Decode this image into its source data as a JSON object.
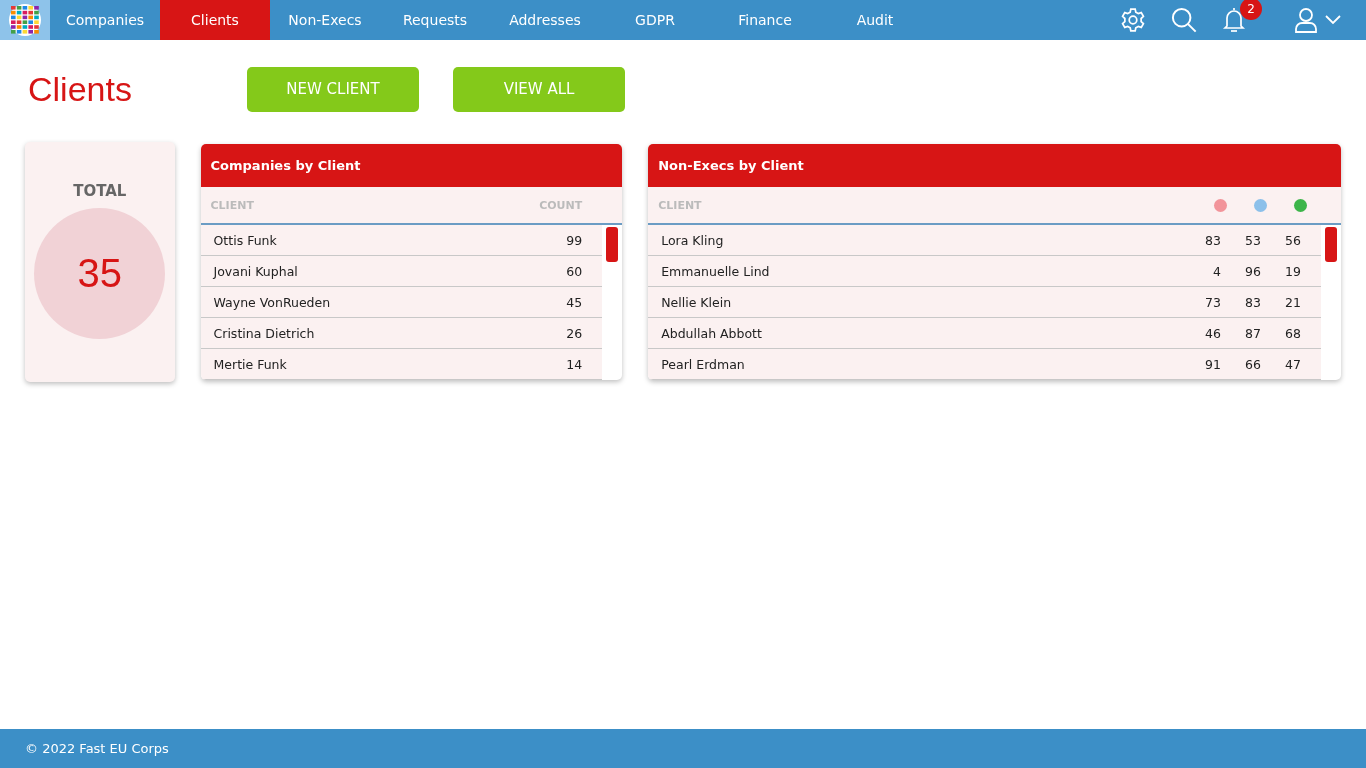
{
  "nav": {
    "items": [
      {
        "label": "Companies",
        "selected": false
      },
      {
        "label": "Clients",
        "selected": true
      },
      {
        "label": "Non-Execs",
        "selected": false
      },
      {
        "label": "Requests",
        "selected": false
      },
      {
        "label": "Addresses",
        "selected": false
      },
      {
        "label": "GDPR",
        "selected": false
      },
      {
        "label": "Finance",
        "selected": false
      },
      {
        "label": "Audit",
        "selected": false
      }
    ],
    "notification_count": "2"
  },
  "page_title": "Clients",
  "buttons": [
    "NEW CLIENT",
    "VIEW ALL"
  ],
  "total": {
    "label": "TOTAL",
    "value": "35"
  },
  "companies_table": {
    "title": "Companies by Client",
    "columns": [
      "CLIENT",
      "COUNT"
    ],
    "rows": [
      [
        "Ottis Funk",
        "99"
      ],
      [
        "Jovani Kuphal",
        "60"
      ],
      [
        "Wayne VonRueden",
        "45"
      ],
      [
        "Cristina Dietrich",
        "26"
      ],
      [
        "Mertie Funk",
        "14"
      ]
    ]
  },
  "nonexecs_table": {
    "title": "Non-Execs by Client",
    "client_column": "CLIENT",
    "dot_columns": [
      {
        "color": "#f2949a"
      },
      {
        "color": "#8cc0ea"
      },
      {
        "color": "#3db54a"
      }
    ],
    "rows": [
      [
        "Lora Kling",
        "83",
        "53",
        "56"
      ],
      [
        "Emmanuelle Lind",
        "4",
        "96",
        "19"
      ],
      [
        "Nellie Klein",
        "73",
        "83",
        "21"
      ],
      [
        "Abdullah Abbott",
        "46",
        "87",
        "68"
      ],
      [
        "Pearl Erdman",
        "91",
        "66",
        "47"
      ]
    ]
  },
  "footer": "© 2022 Fast EU Corps"
}
